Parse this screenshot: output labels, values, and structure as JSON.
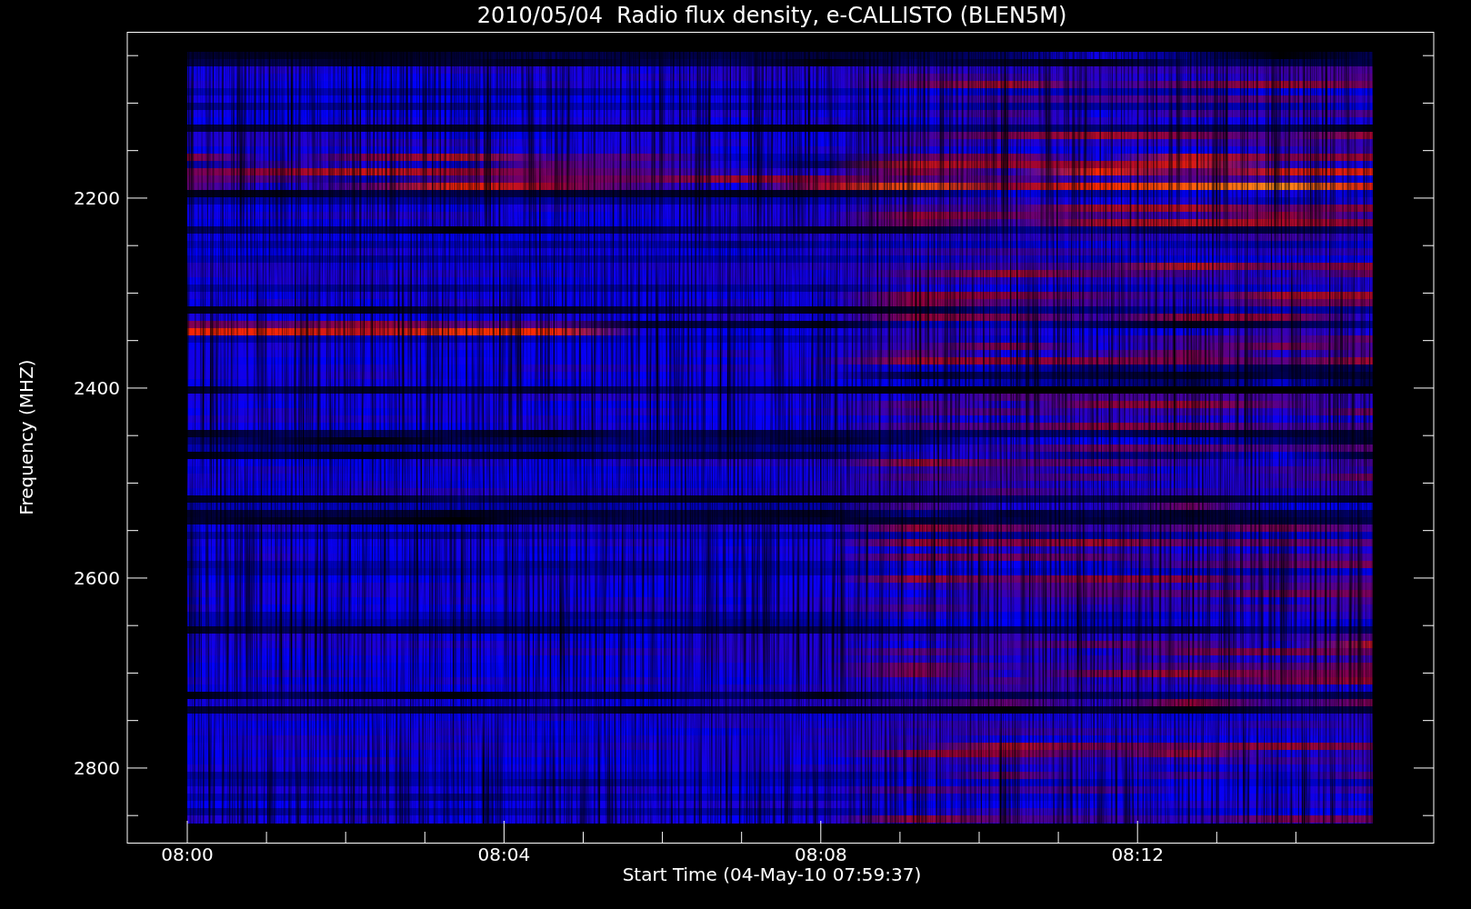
{
  "title": "2010/05/04  Radio flux density, e-CALLISTO (BLEN5M)",
  "x_axis": {
    "label": "Start Time (04-May-10 07:59:37)",
    "ticks": [
      "08:00",
      "08:04",
      "08:08",
      "08:12"
    ]
  },
  "y_axis": {
    "label": "Frequency (MHZ)",
    "ticks": [
      "2200",
      "2400",
      "2600",
      "2800"
    ]
  }
}
